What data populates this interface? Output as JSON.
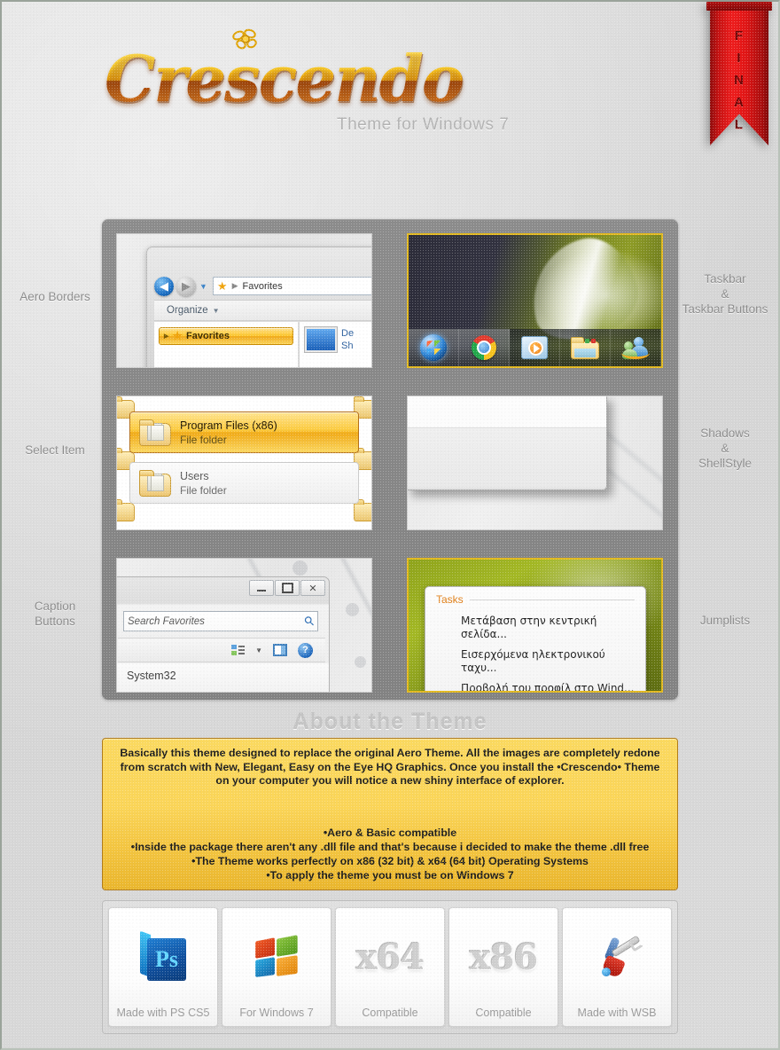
{
  "header": {
    "logo_text": "Crescendo",
    "flower_icon": "flower-icon",
    "subtitle": "Theme  for Windows 7",
    "ribbon": {
      "letters": [
        "F",
        "I",
        "N",
        "A",
        "L"
      ],
      "label": "FINAL"
    }
  },
  "labels": {
    "left": [
      {
        "id": "aero-borders",
        "text": "Aero Borders"
      },
      {
        "id": "select-item",
        "text": "Select Item"
      },
      {
        "id": "caption-buttons",
        "lines": [
          "Caption",
          "Buttons"
        ]
      }
    ],
    "right": [
      {
        "id": "taskbar",
        "lines": [
          "Taskbar",
          "&",
          "Taskbar Buttons"
        ]
      },
      {
        "id": "shadows",
        "lines": [
          "Shadows",
          "&",
          "ShellStyle"
        ]
      },
      {
        "id": "jumplists",
        "text": "Jumplists"
      }
    ]
  },
  "showcase": {
    "aero_borders": {
      "breadcrumb": "Favorites",
      "breadcrumb_icon": "star-icon",
      "back_icon": "back-arrow-icon",
      "forward_icon": "forward-arrow-icon",
      "history_icon": "chevron-down-icon",
      "organize": "Organize",
      "nav_selected": "Favorites",
      "content_line1": "De",
      "content_line2": "Sh"
    },
    "taskbar": {
      "buttons": [
        {
          "name": "start-orb",
          "label": "Start"
        },
        {
          "name": "chrome-icon",
          "label": "Google Chrome"
        },
        {
          "name": "media-player-icon",
          "label": "Windows Media Player"
        },
        {
          "name": "explorer-folder-icon",
          "label": "Windows Explorer"
        },
        {
          "name": "messenger-icon",
          "label": "Windows Live Messenger"
        }
      ]
    },
    "select_item": {
      "rows": [
        {
          "name": "Program Files (x86)",
          "type": "File folder",
          "state": "selected"
        },
        {
          "name": "Users",
          "type": "File folder",
          "state": "hover"
        }
      ]
    },
    "caption_buttons": {
      "minimize": "minimize-icon",
      "maximize": "maximize-icon",
      "close": "✕",
      "search_placeholder": "Search Favorites",
      "search_icon": "magnifier-icon",
      "views_icon": "view-options-icon",
      "caret_icon": "chevron-down-icon",
      "preview_pane_icon": "preview-pane-icon",
      "help_icon": "?",
      "status_text": "System32"
    },
    "jumplists": {
      "heading": "Tasks",
      "items": [
        "Μετάβαση στην κεντρική σελίδα...",
        "Εισερχόμενα ηλεκτρονικού ταχυ...",
        "Προβολή του προφίλ στο Wind..."
      ]
    }
  },
  "about": {
    "title": "About the Theme",
    "paragraph": "Basically this theme designed to replace the original Aero Theme. All the images are completely redone from scratch with New, Elegant, Easy on the Eye HQ Graphics.  Once you install the •Crescendo• Theme on your computer you will notice a new shiny interface of explorer.",
    "bullets": [
      "•Aero & Basic compatible",
      "•Inside the package there aren't any .dll file and that's because i decided to make the theme .dll free",
      "•The Theme works perfectly on x86 (32 bit) & x64 (64 bit) Operating Systems",
      "•To apply the theme you must be on Windows 7"
    ]
  },
  "badges": [
    {
      "icon": "photoshop-icon",
      "art": "",
      "caption": "Made with PS CS5"
    },
    {
      "icon": "windows-flag-icon",
      "art": "",
      "caption": "For Windows 7"
    },
    {
      "icon": "x64-text-icon",
      "art": "x64",
      "caption": "Compatible"
    },
    {
      "icon": "x86-text-icon",
      "art": "x86",
      "caption": "Compatible"
    },
    {
      "icon": "wsb-tools-icon",
      "art": "",
      "caption": "Made with WSB"
    }
  ],
  "colors": {
    "accent_gold": "#fbd557",
    "accent_border": "#b07b1b",
    "ribbon_red": "#ee1c1c",
    "grid_gray": "#878787",
    "page_bg": "#d9d9d9"
  }
}
